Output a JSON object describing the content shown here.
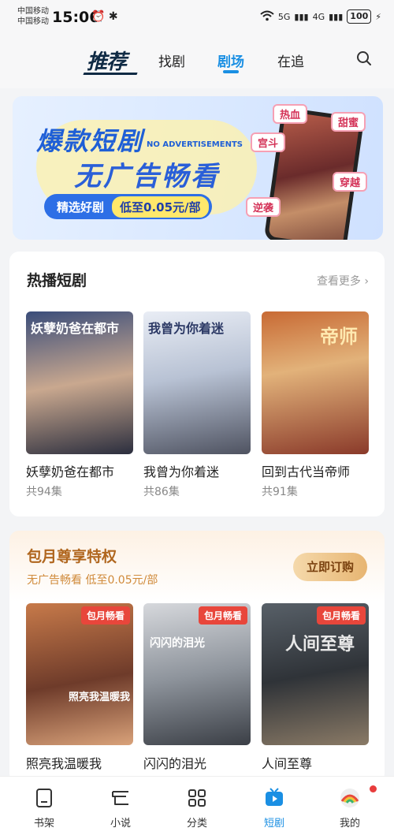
{
  "status_bar": {
    "carrier1": "中国移动",
    "carrier2": "中国移动",
    "time": "15:06",
    "net1": "5G",
    "net2": "4G",
    "battery": "100"
  },
  "top_tabs": {
    "recommend": "推荐",
    "find": "找剧",
    "theater": "剧场",
    "following": "在追"
  },
  "banner": {
    "headline1": "爆款短剧",
    "headline2": "无广告畅看",
    "no_ads": "NO ADVERTISEMENTS",
    "pill_left": "精选好剧",
    "pill_right": "低至0.05元/部",
    "tags": [
      "热血",
      "甜蜜",
      "宫斗",
      "穿越",
      "逆袭"
    ]
  },
  "hot_section": {
    "title": "热播短剧",
    "more": "查看更多",
    "items": [
      {
        "name": "妖孽奶爸在都市",
        "episodes": "共94集",
        "poster_text": "妖孽奶爸在都市"
      },
      {
        "name": "我曾为你着迷",
        "episodes": "共86集",
        "poster_text": "我曾为你着迷"
      },
      {
        "name": "回到古代当帝师",
        "episodes": "共91集",
        "poster_text": "帝师"
      }
    ]
  },
  "vip_section": {
    "title": "包月尊享特权",
    "subtitle": "无广告畅看 低至0.05元/部",
    "button": "立即订购",
    "badge": "包月畅看",
    "items": [
      {
        "name": "照亮我温暖我",
        "poster_text": "照亮我温暖我"
      },
      {
        "name": "闪闪的泪光",
        "poster_text": "闪闪的泪光"
      },
      {
        "name": "人间至尊",
        "poster_text": "人间至尊"
      }
    ]
  },
  "bottom_nav": {
    "bookshelf": "书架",
    "novel": "小说",
    "category": "分类",
    "drama": "短剧",
    "mine": "我的"
  },
  "colors": {
    "accent": "#1a8fe3",
    "vip_gold": "#b0661e",
    "badge_red": "#e8463b"
  }
}
